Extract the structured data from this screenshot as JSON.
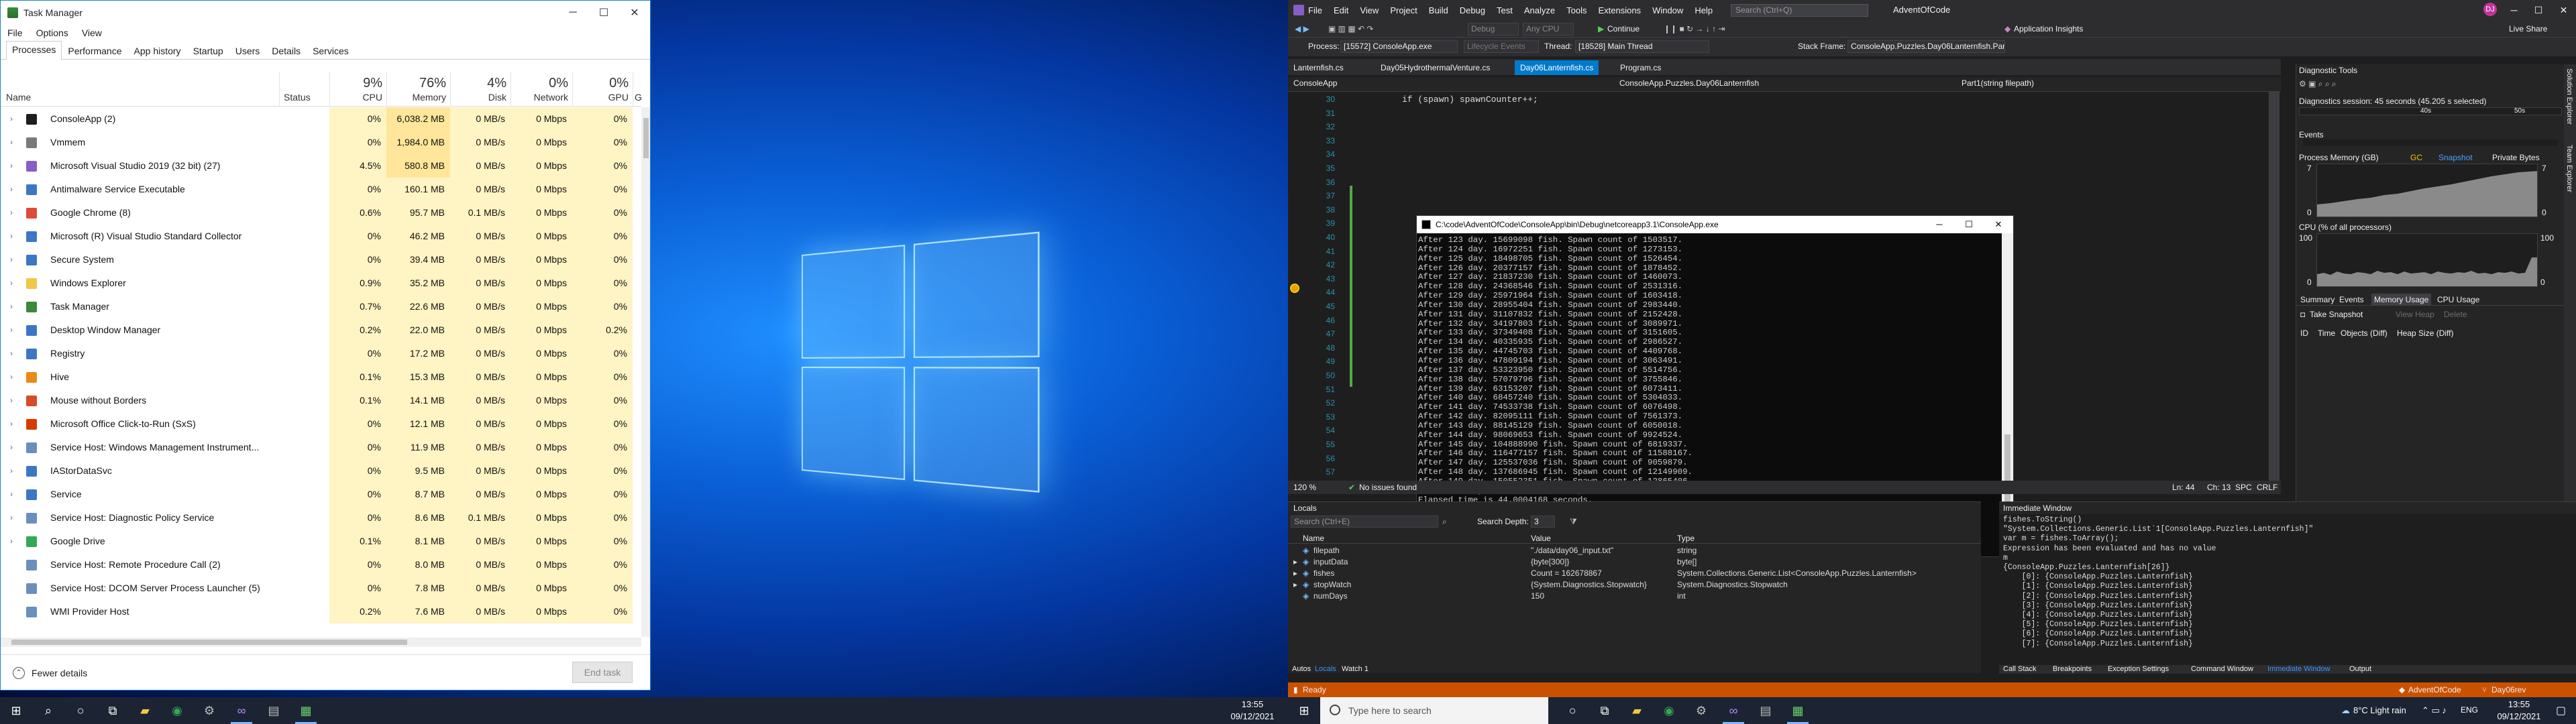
{
  "taskmanager": {
    "title": "Task Manager",
    "menu": [
      "File",
      "Options",
      "View"
    ],
    "tabs": [
      "Processes",
      "Performance",
      "App history",
      "Startup",
      "Users",
      "Details",
      "Services"
    ],
    "columns": {
      "name": "Name",
      "status": "Status",
      "cpu_pct": "9%",
      "cpu": "CPU",
      "mem_pct": "76%",
      "mem": "Memory",
      "disk_pct": "4%",
      "disk": "Disk",
      "net_pct": "0%",
      "net": "Network",
      "gpu_pct": "0%",
      "gpu": "GPU",
      "extra": "GI"
    },
    "rows": [
      {
        "name": "ConsoleApp (2)",
        "cpu": "0%",
        "mem": "6,038.2 MB",
        "disk": "0 MB/s",
        "net": "0 Mbps",
        "gpu": "0%",
        "color": "#1e1e1e"
      },
      {
        "name": "Vmmem",
        "cpu": "0%",
        "mem": "1,984.0 MB",
        "disk": "0 MB/s",
        "net": "0 Mbps",
        "gpu": "0%",
        "color": "#7a7a7a"
      },
      {
        "name": "Microsoft Visual Studio 2019 (32 bit) (27)",
        "cpu": "4.5%",
        "mem": "580.8 MB",
        "disk": "0 MB/s",
        "net": "0 Mbps",
        "gpu": "0%",
        "color": "#865fc5"
      },
      {
        "name": "Antimalware Service Executable",
        "cpu": "0%",
        "mem": "160.1 MB",
        "disk": "0 MB/s",
        "net": "0 Mbps",
        "gpu": "0%",
        "color": "#3b78c4"
      },
      {
        "name": "Google Chrome (8)",
        "cpu": "0.6%",
        "mem": "95.7 MB",
        "disk": "0.1 MB/s",
        "net": "0 Mbps",
        "gpu": "0%",
        "color": "#dd4b39"
      },
      {
        "name": "Microsoft (R) Visual Studio Standard Collector",
        "cpu": "0%",
        "mem": "46.2 MB",
        "disk": "0 MB/s",
        "net": "0 Mbps",
        "gpu": "0%",
        "color": "#3b78c4"
      },
      {
        "name": "Secure System",
        "cpu": "0%",
        "mem": "39.4 MB",
        "disk": "0 MB/s",
        "net": "0 Mbps",
        "gpu": "0%",
        "color": "#3b78c4"
      },
      {
        "name": "Windows Explorer",
        "cpu": "0.9%",
        "mem": "35.2 MB",
        "disk": "0 MB/s",
        "net": "0 Mbps",
        "gpu": "0%",
        "color": "#f2c744"
      },
      {
        "name": "Task Manager",
        "cpu": "0.7%",
        "mem": "22.6 MB",
        "disk": "0 MB/s",
        "net": "0 Mbps",
        "gpu": "0%",
        "color": "#3a8a3a"
      },
      {
        "name": "Desktop Window Manager",
        "cpu": "0.2%",
        "mem": "22.0 MB",
        "disk": "0 MB/s",
        "net": "0 Mbps",
        "gpu": "0.2%",
        "color": "#3b78c4"
      },
      {
        "name": "Registry",
        "cpu": "0%",
        "mem": "17.2 MB",
        "disk": "0 MB/s",
        "net": "0 Mbps",
        "gpu": "0%",
        "color": "#3b78c4"
      },
      {
        "name": "Hive",
        "cpu": "0.1%",
        "mem": "15.3 MB",
        "disk": "0 MB/s",
        "net": "0 Mbps",
        "gpu": "0%",
        "color": "#e88b1a"
      },
      {
        "name": "Mouse without Borders",
        "cpu": "0.1%",
        "mem": "14.1 MB",
        "disk": "0 MB/s",
        "net": "0 Mbps",
        "gpu": "0%",
        "color": "#d84b2a"
      },
      {
        "name": "Microsoft Office Click-to-Run (SxS)",
        "cpu": "0%",
        "mem": "12.1 MB",
        "disk": "0 MB/s",
        "net": "0 Mbps",
        "gpu": "0%",
        "color": "#d83b01"
      },
      {
        "name": "Service Host: Windows Management Instrument...",
        "cpu": "0%",
        "mem": "11.9 MB",
        "disk": "0 MB/s",
        "net": "0 Mbps",
        "gpu": "0%",
        "color": "#6a8fbf"
      },
      {
        "name": "IAStorDataSvc",
        "cpu": "0%",
        "mem": "9.5 MB",
        "disk": "0 MB/s",
        "net": "0 Mbps",
        "gpu": "0%",
        "color": "#3b78c4"
      },
      {
        "name": "Service",
        "cpu": "0%",
        "mem": "8.7 MB",
        "disk": "0 MB/s",
        "net": "0 Mbps",
        "gpu": "0%",
        "color": "#3b78c4"
      },
      {
        "name": "Service Host: Diagnostic Policy Service",
        "cpu": "0%",
        "mem": "8.6 MB",
        "disk": "0.1 MB/s",
        "net": "0 Mbps",
        "gpu": "0%",
        "color": "#6a8fbf"
      },
      {
        "name": "Google Drive",
        "cpu": "0.1%",
        "mem": "8.1 MB",
        "disk": "0 MB/s",
        "net": "0 Mbps",
        "gpu": "0%",
        "color": "#34a853"
      },
      {
        "name": "Service Host: Remote Procedure Call (2)",
        "cpu": "0%",
        "mem": "8.0 MB",
        "disk": "0 MB/s",
        "net": "0 Mbps",
        "gpu": "0%",
        "color": "#6a8fbf"
      },
      {
        "name": "Service Host: DCOM Server Process Launcher (5)",
        "cpu": "0%",
        "mem": "7.8 MB",
        "disk": "0 MB/s",
        "net": "0 Mbps",
        "gpu": "0%",
        "color": "#6a8fbf"
      },
      {
        "name": "WMI Provider Host",
        "cpu": "0.2%",
        "mem": "7.6 MB",
        "disk": "0 MB/s",
        "net": "0 Mbps",
        "gpu": "0%",
        "color": "#6a8fbf"
      }
    ],
    "fewer_details": "Fewer details",
    "end_task": "End task"
  },
  "taskbar1": {
    "time": "13:55",
    "date": "09/12/2021"
  },
  "vs": {
    "menu": [
      "File",
      "Edit",
      "View",
      "Project",
      "Build",
      "Debug",
      "Test",
      "Analyze",
      "Tools",
      "Extensions",
      "Window",
      "Help"
    ],
    "search": "Search (Ctrl+Q)",
    "solution": "AdventOfCode",
    "toolbar": {
      "debug": "Debug",
      "anycpu": "Any CPU",
      "continue": "Continue",
      "app_insights": "Application Insights",
      "live_share": "Live Share"
    },
    "toolbar2": {
      "process_label": "Process:",
      "process": "[15572] ConsoleApp.exe",
      "lifecycle": "Lifecycle Events",
      "thread_label": "Thread:",
      "thread": "[18528] Main Thread",
      "stackframe_label": "Stack Frame:",
      "stackframe": "ConsoleApp.Puzzles.Day06Lanternfish.Par"
    },
    "tabs": [
      "Lanternfish.cs",
      "Day05HydrothermalVenture.cs",
      "Day06Lanternfish.cs",
      "Program.cs"
    ],
    "nav": {
      "left": "ConsoleApp",
      "mid": "ConsoleApp.Puzzles.Day06Lanternfish",
      "right": "Part1(string filepath)"
    },
    "code_line": "if (spawn) spawnCounter++;",
    "line_numbers": [
      "30",
      "31",
      "32",
      "33",
      "34",
      "35",
      "36",
      "37",
      "38",
      "39",
      "40",
      "41",
      "42",
      "43",
      "44",
      "45",
      "46",
      "47",
      "48",
      "49",
      "50",
      "51",
      "52",
      "53",
      "54",
      "55",
      "56",
      "57"
    ],
    "editor_status": {
      "zoom": "120 %",
      "issues": "No issues found",
      "ln": "Ln: 44",
      "ch": "Ch: 13",
      "spc": "SPC",
      "crlf": "CRLF"
    },
    "console": {
      "title": "C:\\code\\AdventOfCode\\ConsoleApp\\bin\\Debug\\netcoreapp3.1\\ConsoleApp.exe",
      "lines": [
        "After 123 day. 15699098 fish. Spawn count of 1503517.",
        "After 124 day. 16972251 fish. Spawn count of 1273153.",
        "After 125 day. 18498705 fish. Spawn count of 1526454.",
        "After 126 day. 20377157 fish. Spawn count of 1878452.",
        "After 127 day. 21837230 fish. Spawn count of 1460073.",
        "After 128 day. 24368546 fish. Spawn count of 2531316.",
        "After 129 day. 25971964 fish. Spawn count of 1603418.",
        "After 130 day. 28955404 fish. Spawn count of 2983440.",
        "After 131 day. 31107832 fish. Spawn count of 2152428.",
        "After 132 day. 34197803 fish. Spawn count of 3089971.",
        "After 133 day. 37349408 fish. Spawn count of 3151605.",
        "After 134 day. 40335935 fish. Spawn count of 2986527.",
        "After 135 day. 44745703 fish. Spawn count of 4409768.",
        "After 136 day. 47809194 fish. Spawn count of 3063491.",
        "After 137 day. 53323950 fish. Spawn count of 5514756.",
        "After 138 day. 57079796 fish. Spawn count of 3755846.",
        "After 139 day. 63153207 fish. Spawn count of 6073411.",
        "After 140 day. 68457240 fish. Spawn count of 5304033.",
        "After 141 day. 74533738 fish. Spawn count of 6076498.",
        "After 142 day. 82095111 fish. Spawn count of 7561373.",
        "After 143 day. 88145129 fish. Spawn count of 6050018.",
        "After 144 day. 98069653 fish. Spawn count of 9924524.",
        "After 145 day. 104888990 fish. Spawn count of 6819337.",
        "After 146 day. 116477157 fish. Spawn count of 11588167.",
        "After 147 day. 125537036 fish. Spawn count of 9059879.",
        "After 148 day. 137686945 fish. Spawn count of 12149909.",
        "After 149 day. 150552351 fish. Spawn count of 12865406.",
        "After 150 day. 162678867 fish. Spawn count of 12126516.",
        "Elapsed time is 44.0004168 seconds.",
        "",
        "_"
      ]
    },
    "diag": {
      "title": "Diagnostic Tools",
      "session": "Diagnostics session: 45 seconds (45.205 s selected)",
      "t1": "40s",
      "t2": "50s",
      "events": "Events",
      "process_memory": "Process Memory (GB)",
      "gc": "GC",
      "snapshot": "Snapshot",
      "private_bytes": "Private Bytes",
      "mem_max": "7",
      "mem_min": "0",
      "cpu_title": "CPU (% of all processors)",
      "cpu_max": "100",
      "cpu_min": "0",
      "subtabs": [
        "Summary",
        "Events",
        "Memory Usage",
        "CPU Usage"
      ],
      "take_snapshot": "Take Snapshot",
      "view_heap": "View Heap",
      "delete": "Delete",
      "cols": [
        "ID",
        "Time",
        "Objects (Diff)",
        "Heap Size (Diff)"
      ]
    },
    "side_tabs": [
      "Solution Explorer",
      "Team Explorer"
    ],
    "locals": {
      "title": "Locals",
      "search": "Search (Ctrl+E)",
      "depth_label": "Search Depth:",
      "depth": "3",
      "cols": [
        "Name",
        "Value",
        "Type"
      ],
      "rows": [
        {
          "name": "filepath",
          "value": "\"./data/day06_input.txt\"",
          "type": "string"
        },
        {
          "name": "inputData",
          "value": "{byte[300]}",
          "type": "byte[]"
        },
        {
          "name": "fishes",
          "value": "Count = 162678867",
          "type": "System.Collections.Generic.List<ConsoleApp.Puzzles.Lanternfish>"
        },
        {
          "name": "stopWatch",
          "value": "{System.Diagnostics.Stopwatch}",
          "type": "System.Diagnostics.Stopwatch"
        },
        {
          "name": "numDays",
          "value": "150",
          "type": "int"
        }
      ],
      "tabs": [
        "Autos",
        "Locals",
        "Watch 1"
      ]
    },
    "immediate": {
      "title": "Immediate Window",
      "lines": [
        "fishes.ToString()",
        "\"System.Collections.Generic.List`1[ConsoleApp.Puzzles.Lanternfish]\"",
        "var m = fishes.ToArray();",
        "Expression has been evaluated and has no value",
        "m",
        "{ConsoleApp.Puzzles.Lanternfish[26]}",
        "    [0]: {ConsoleApp.Puzzles.Lanternfish}",
        "    [1]: {ConsoleApp.Puzzles.Lanternfish}",
        "    [2]: {ConsoleApp.Puzzles.Lanternfish}",
        "    [3]: {ConsoleApp.Puzzles.Lanternfish}",
        "    [4]: {ConsoleApp.Puzzles.Lanternfish}",
        "    [5]: {ConsoleApp.Puzzles.Lanternfish}",
        "    [6]: {ConsoleApp.Puzzles.Lanternfish}",
        "    [7]: {ConsoleApp.Puzzles.Lanternfish}"
      ],
      "tabs": [
        "Call Stack",
        "Breakpoints",
        "Exception Settings",
        "Command Window",
        "Immediate Window",
        "Output"
      ]
    },
    "status": {
      "ready": "Ready",
      "repo": "AdventOfCode",
      "branch": "Day06rev"
    }
  },
  "taskbar2": {
    "search": "Type here to search",
    "weather": "8°C  Light rain",
    "lang": "ENG",
    "time": "13:55",
    "date": "09/12/2021"
  }
}
